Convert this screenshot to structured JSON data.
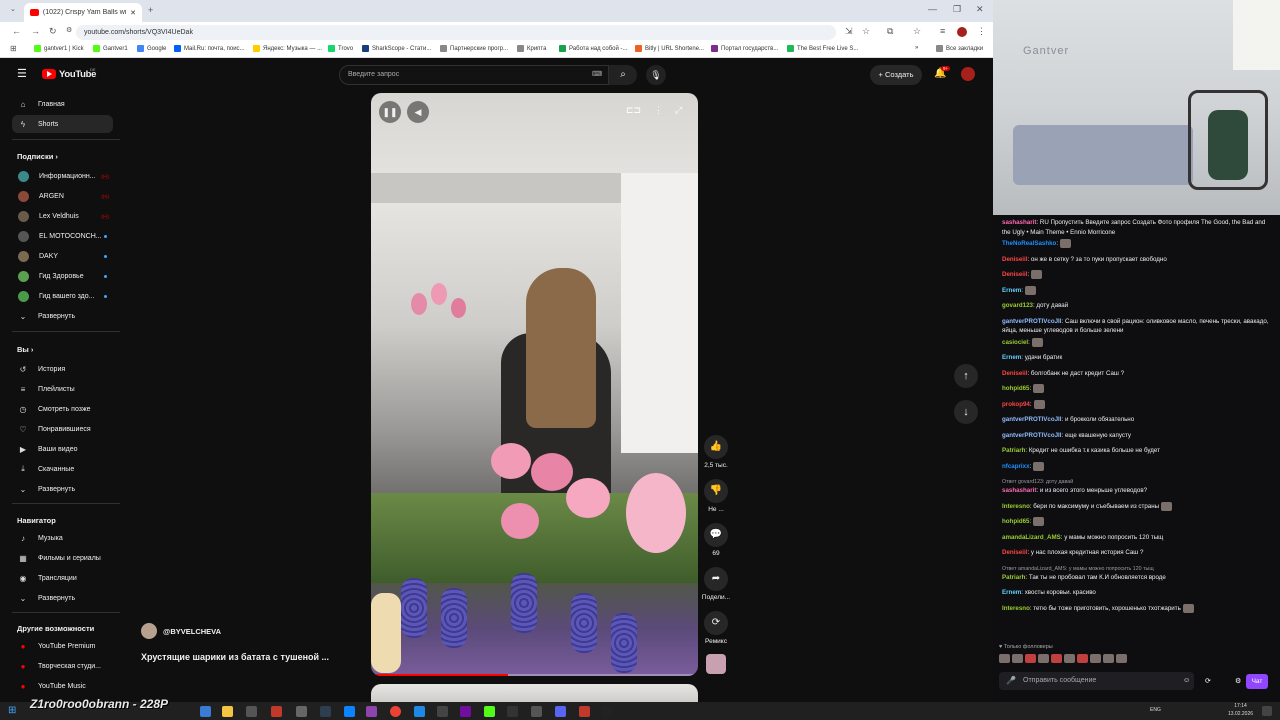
{
  "browser": {
    "tab_title": "(1022) Crispy Yam Balls with ...",
    "new_tab": "+",
    "url": "youtube.com/shorts/VQ3VI4UeDak",
    "window_controls": [
      "—",
      "❐",
      "✕"
    ],
    "bookmarks": [
      {
        "label": "gantver1 | Kick",
        "color": "#53fc18"
      },
      {
        "label": "Gantver1",
        "color": "#53fc18"
      },
      {
        "label": "Google",
        "color": "#4285f4"
      },
      {
        "label": "Mail.Ru: почта, поис...",
        "color": "#005ff9"
      },
      {
        "label": "Яндекс: Музыка — ...",
        "color": "#ffcc00"
      },
      {
        "label": "Trovo",
        "color": "#19d66b"
      },
      {
        "label": "SharkScope - Стати...",
        "color": "#1a3d7c"
      },
      {
        "label": "Партнерские прогр...",
        "color": "#888888"
      },
      {
        "label": "Крипта",
        "color": "#888888"
      },
      {
        "label": "Работа над собой -...",
        "color": "#16a34a"
      },
      {
        "label": "Bitly | URL Shortene...",
        "color": "#ee6123"
      },
      {
        "label": "Портал государств...",
        "color": "#7b2d8e"
      },
      {
        "label": "The Best Free Live S...",
        "color": "#1db954"
      },
      {
        "label": "Все закладки",
        "color": "#888888"
      }
    ]
  },
  "youtube": {
    "logo_text": "YouTube",
    "logo_region": "DE",
    "search_placeholder": "Введите запрос",
    "create_label": "+ Создать",
    "notif_badge": "9+",
    "sidebar": {
      "main": [
        {
          "label": "Главная",
          "icon": "⌂"
        },
        {
          "label": "Shorts",
          "icon": "ϟ"
        }
      ],
      "subs_heading": "Подписки ›",
      "subs": [
        {
          "label": "Информационн...",
          "marker": "live"
        },
        {
          "label": "ARGEN",
          "marker": "live"
        },
        {
          "label": "Lex Veldhuis",
          "marker": "live"
        },
        {
          "label": "EL MOTOCONCH...",
          "marker": "dot"
        },
        {
          "label": "DAKY",
          "marker": "dot"
        },
        {
          "label": "Гид Здоровье",
          "marker": "dot"
        },
        {
          "label": "Гид вашего здо...",
          "marker": "dot"
        }
      ],
      "subs_expand": "Развернуть",
      "you_heading": "Вы ›",
      "you": [
        {
          "label": "История",
          "icon": "↺"
        },
        {
          "label": "Плейлисты",
          "icon": "≡"
        },
        {
          "label": "Смотреть позже",
          "icon": "◷"
        },
        {
          "label": "Понравившиеся",
          "icon": "👍"
        },
        {
          "label": "Ваши видео",
          "icon": "▶"
        },
        {
          "label": "Скачанные",
          "icon": "⬇"
        }
      ],
      "you_expand": "Развернуть",
      "nav_heading": "Навигатор",
      "nav": [
        {
          "label": "Музыка",
          "icon": "♪"
        },
        {
          "label": "Фильмы и сериалы",
          "icon": "▦"
        },
        {
          "label": "Трансляции",
          "icon": "◉"
        }
      ],
      "nav_expand": "Развернуть",
      "more_heading": "Другие возможности",
      "more": [
        {
          "label": "YouTube Premium"
        },
        {
          "label": "Творческая студи..."
        },
        {
          "label": "YouTube Music"
        }
      ]
    },
    "short": {
      "channel": "@BYVELCHEVA",
      "title": "Хрустящие шарики из батата с тушеной ...",
      "progress": 0.42,
      "actions": [
        {
          "name": "like",
          "icon": "👍",
          "label": "2,5 тыс."
        },
        {
          "name": "dislike",
          "icon": "👎",
          "label": "Не ..."
        },
        {
          "name": "comments",
          "icon": "💬",
          "label": "69"
        },
        {
          "name": "share",
          "icon": "➦",
          "label": "Подели..."
        },
        {
          "name": "remix",
          "icon": "⟳",
          "label": "Ремикс"
        }
      ]
    }
  },
  "stream": {
    "webcam_sign": "Gantver",
    "chat": [
      {
        "user": "sashasharit",
        "color": "#ff69b4",
        "text": ": RU Пропустить Введите запрос Создать Фото профиля The Good, the Bad and the Ugly • Main Theme • Ennio Morricone"
      },
      {
        "user": "TheNoRealSashko",
        "color": "#1e90ff",
        "text": ":",
        "emote": true
      },
      {
        "user": "Deniseiil",
        "color": "#ff4444",
        "text": ": он же в сетку ? за то пуки пропускает свободно"
      },
      {
        "user": "Deniseiil",
        "color": "#ff4444",
        "text": ":",
        "emote": true
      },
      {
        "user": "Ernem",
        "color": "#5fd0ff",
        "text": ":",
        "emote": true
      },
      {
        "user": "govard123",
        "color": "#9acd32",
        "text": ": доту давай"
      },
      {
        "user": "gantverPROTIVcoJII",
        "color": "#8fbcff",
        "text": ": Саш включи в свой рацион: оливковое масло, печень трески, авакадо, яйца, меньше углеводов и больше зелени"
      },
      {
        "user": "casiociel",
        "color": "#9acd32",
        "text": ":",
        "emote": true
      },
      {
        "user": "Ernem",
        "color": "#5fd0ff",
        "text": ": удачи братик"
      },
      {
        "user": "Deniseiil",
        "color": "#ff4444",
        "text": ": болгобанк не даст кредит Саш ?"
      },
      {
        "user": "hohpid65",
        "color": "#9acd32",
        "text": ":",
        "emote": true
      },
      {
        "user": "prokop94",
        "color": "#ff4444",
        "text": ":",
        "emote": true
      },
      {
        "user": "gantverPROTIVcoJII",
        "color": "#8fbcff",
        "text": ": и брокколи обязательно"
      },
      {
        "user": "gantverPROTIVcoJII",
        "color": "#8fbcff",
        "text": ": еще квашеную капусту"
      },
      {
        "user": "Patriarh",
        "color": "#9acd32",
        "text": ": Кредит не ошибка т.к казика больше не будет"
      },
      {
        "user": "nfcaprixx",
        "color": "#1e90ff",
        "text": ":",
        "emote": true
      },
      {
        "reply": "Ответ govard123: доту давай"
      },
      {
        "user": "sashasharit",
        "color": "#ff69b4",
        "text": ": и из всего этого менрьше углеводов?"
      },
      {
        "user": "Interesno",
        "color": "#9acd32",
        "text": ": бери по максимуму и съебываем из страны",
        "emote": true
      },
      {
        "user": "hohpid65",
        "color": "#9acd32",
        "text": ":",
        "emote": true
      },
      {
        "user": "amandaLizard_AMS",
        "color": "#9acd32",
        "text": ": у мамы можно попросить 120 тыщ"
      },
      {
        "user": "Deniseiil",
        "color": "#ff4444",
        "text": ": у нас плохая кредитная история Саш ?"
      },
      {
        "reply": "Ответ amandaLizard_AMS: у мамы можно попросить 120 тыщ"
      },
      {
        "user": "Patriarh",
        "color": "#9acd32",
        "text": ": Так ты не пробовал там К.И обновляется вроде"
      },
      {
        "user": "Ernem",
        "color": "#5fd0ff",
        "text": ": хвосты коровьи. красиво"
      },
      {
        "user": "Interesno",
        "color": "#9acd32",
        "text": ": тетю бы тоже приготовить, хорошенько тхотжарить",
        "emote": true
      }
    ],
    "followers_only": "♥ Только фолловеры",
    "chat_placeholder": "Отправить сообщение",
    "chat_button": "Чат"
  },
  "taskbar": {
    "overlay": "Z1ro0roo0obrann - 228P",
    "time": "17:14",
    "date": "13.02.2026",
    "lang": "ENG"
  }
}
